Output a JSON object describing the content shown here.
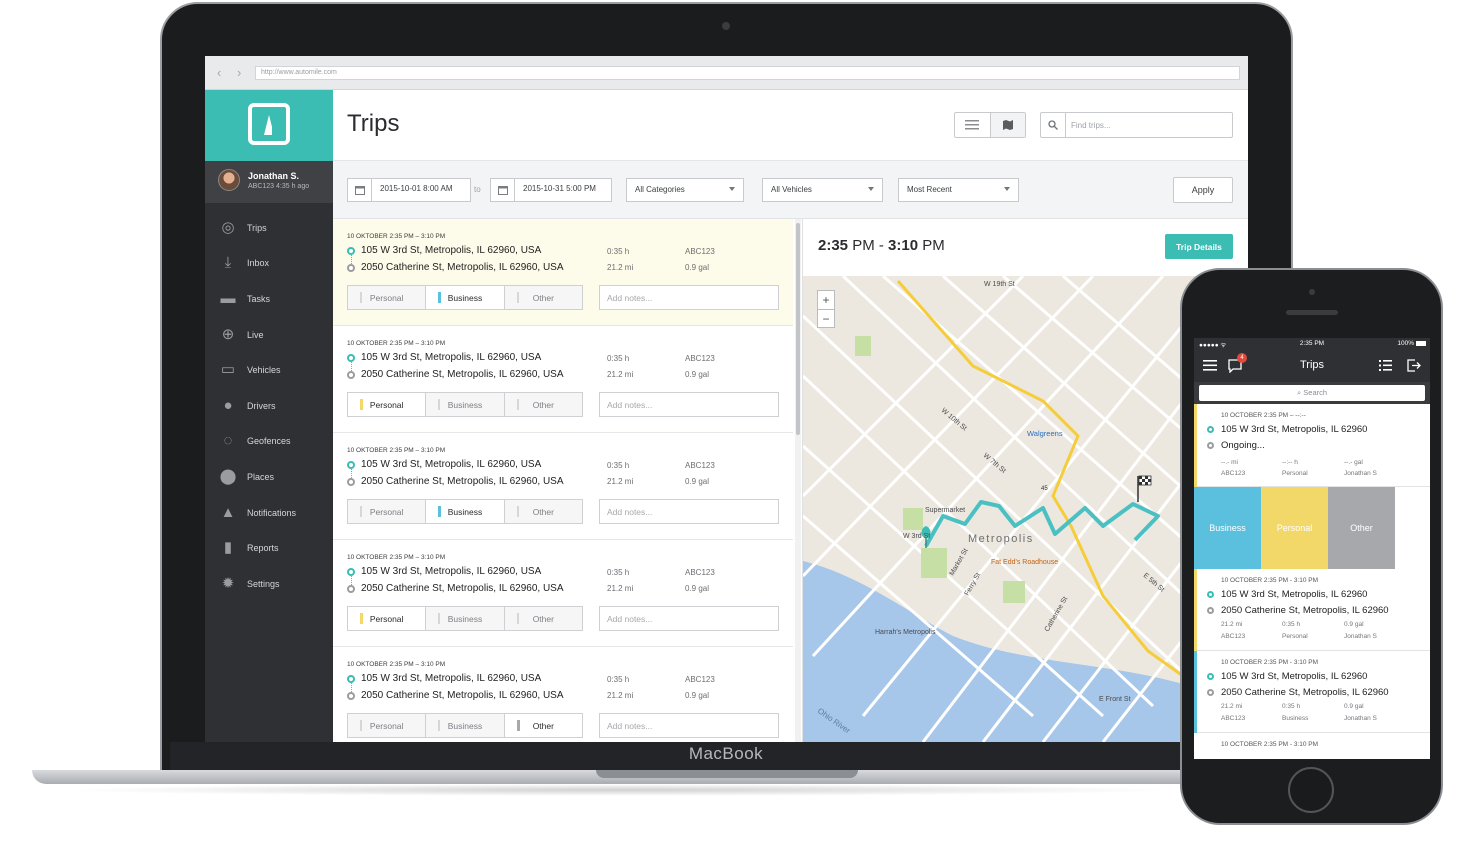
{
  "laptop": {
    "brand": "MacBook"
  },
  "browser": {
    "url": "http://www.automile.com"
  },
  "sidebar": {
    "user": {
      "name": "Jonathan S.",
      "sub": "ABC123 4:35 h ago"
    },
    "items": [
      {
        "label": "Trips",
        "icon": "steering-wheel-icon"
      },
      {
        "label": "Inbox",
        "icon": "inbox-icon"
      },
      {
        "label": "Tasks",
        "icon": "chat-icon"
      },
      {
        "label": "Live",
        "icon": "crosshair-icon"
      },
      {
        "label": "Vehicles",
        "icon": "car-icon"
      },
      {
        "label": "Drivers",
        "icon": "person-icon"
      },
      {
        "label": "Geofences",
        "icon": "geofence-icon"
      },
      {
        "label": "Places",
        "icon": "pin-icon"
      },
      {
        "label": "Notifications",
        "icon": "bell-icon"
      },
      {
        "label": "Reports",
        "icon": "book-icon"
      },
      {
        "label": "Settings",
        "icon": "gear-icon"
      }
    ]
  },
  "header": {
    "title": "Trips",
    "search_placeholder": "Find trips..."
  },
  "filters": {
    "date_from": "2015-10-01 8:00 AM",
    "to_label": "to",
    "date_to": "2015-10-31 5:00 PM",
    "category": "All Categories",
    "vehicle": "All Vehicles",
    "sort": "Most Recent",
    "apply": "Apply"
  },
  "trips": [
    {
      "date": "10 OKTOBER 2:35 PM – 3:10 PM",
      "from": "105 W 3rd St, Metropolis, IL 62960, USA",
      "to": "2050 Catherine St, Metropolis, IL 62960, USA",
      "duration": "0:35 h",
      "distance": "21.2 mi",
      "vehicle": "ABC123",
      "fuel": "0.9 gal",
      "category": "Business",
      "selected": true
    },
    {
      "date": "10 OKTOBER 2:35 PM – 3:10 PM",
      "from": "105 W 3rd St, Metropolis, IL 62960, USA",
      "to": "2050 Catherine St, Metropolis, IL 62960, USA",
      "duration": "0:35 h",
      "distance": "21.2 mi",
      "vehicle": "ABC123",
      "fuel": "0.9 gal",
      "category": "Personal",
      "selected": false
    },
    {
      "date": "10 OKTOBER 2:35 PM – 3:10 PM",
      "from": "105 W 3rd St, Metropolis, IL 62960, USA",
      "to": "2050 Catherine St, Metropolis, IL 62960, USA",
      "duration": "0:35 h",
      "distance": "21.2 mi",
      "vehicle": "ABC123",
      "fuel": "0.9 gal",
      "category": "Business",
      "selected": false
    },
    {
      "date": "10 OKTOBER 2:35 PM – 3:10 PM",
      "from": "105 W 3rd St, Metropolis, IL 62960, USA",
      "to": "2050 Catherine St, Metropolis, IL 62960, USA",
      "duration": "0:35 h",
      "distance": "21.2 mi",
      "vehicle": "ABC123",
      "fuel": "0.9 gal",
      "category": "Personal",
      "selected": false
    },
    {
      "date": "10 OKTOBER 2:35 PM – 3:10 PM",
      "from": "105 W 3rd St, Metropolis, IL 62960, USA",
      "to": "2050 Catherine St, Metropolis, IL 62960, USA",
      "duration": "0:35 h",
      "distance": "21.2 mi",
      "vehicle": "ABC123",
      "fuel": "0.9 gal",
      "category": "Other",
      "selected": false
    }
  ],
  "categories": {
    "personal": "Personal",
    "business": "Business",
    "other": "Other",
    "notes_placeholder": "Add notes...",
    "colors": {
      "Personal": "#f2d769",
      "Business": "#5bc0de",
      "Other": "#a7a8ab"
    }
  },
  "detail": {
    "start": "2:35",
    "start_ampm": " PM",
    "sep": " - ",
    "end": "3:10",
    "end_ampm": " PM",
    "button": "Trip Details"
  },
  "map": {
    "city": "Metropolis",
    "labels": [
      "W 19th St",
      "Walgreens",
      "Supermarket",
      "Fat Edd's Roadhouse",
      "Harrah's Metropolis",
      "Ohio River",
      "E Front St",
      "W 3rd St",
      "Ferry St",
      "Market St",
      "W 10th St",
      "W 7th St",
      "Catherine St",
      "E 5th St",
      "45"
    ]
  },
  "phone": {
    "status": {
      "time": "2:35 PM",
      "battery": "100%"
    },
    "badge": "4",
    "title": "Trips",
    "search": "Search",
    "ongoing": {
      "date": "10 OCTOBER 2:35 PM – --:--",
      "from": "105 W 3rd St, Metropolis, IL 62960",
      "to": "Ongoing...",
      "m1": "--.- mi",
      "m2": "--:-- h",
      "m3": "--.- gal",
      "s1": "ABC123",
      "s2": "Personal",
      "s3": "Jonathan S"
    },
    "categories": [
      "Business",
      "Personal",
      "Other"
    ],
    "trips": [
      {
        "date": "10 OCTOBER 2:35 PM - 3:10 PM",
        "from": "105 W 3rd St, Metropolis, IL 62960",
        "to": "2050 Catherine St, Metropolis, IL 62960",
        "m1": "21.2 mi",
        "m2": "0:35 h",
        "m3": "0.9 gal",
        "s1": "ABC123",
        "s2": "Personal",
        "s3": "Jonathan S"
      },
      {
        "date": "10 OCTOBER 2:35 PM - 3:10 PM",
        "from": "105 W 3rd St, Metropolis, IL 62960",
        "to": "2050 Catherine St, Metropolis, IL 62960",
        "m1": "21.2 mi",
        "m2": "0:35 h",
        "m3": "0.9 gal",
        "s1": "ABC123",
        "s2": "Business",
        "s3": "Jonathan S"
      },
      {
        "date": "10 OCTOBER 2:35 PM - 3:10 PM"
      }
    ]
  }
}
